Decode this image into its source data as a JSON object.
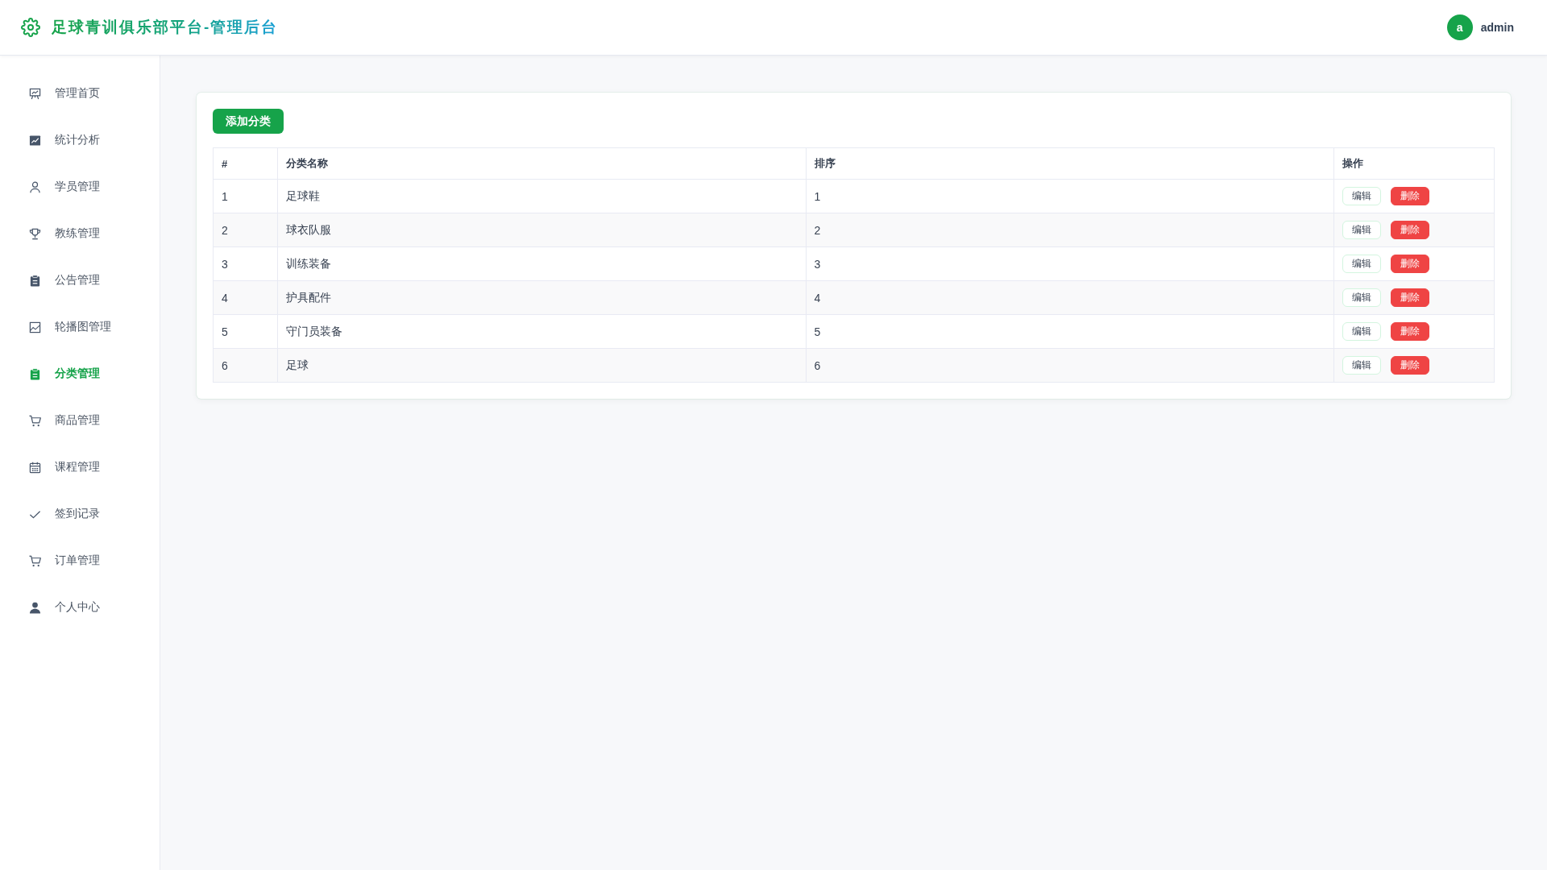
{
  "header": {
    "title": "足球青训俱乐部平台-管理后台",
    "user": {
      "avatar": "a",
      "name": "admin"
    }
  },
  "sidebar": {
    "items": [
      {
        "label": "管理首页",
        "selected": false
      },
      {
        "label": "统计分析",
        "selected": false
      },
      {
        "label": "学员管理",
        "selected": false
      },
      {
        "label": "教练管理",
        "selected": false
      },
      {
        "label": "公告管理",
        "selected": false
      },
      {
        "label": "轮播图管理",
        "selected": false
      },
      {
        "label": "分类管理",
        "selected": true
      },
      {
        "label": "商品管理",
        "selected": false
      },
      {
        "label": "课程管理",
        "selected": false
      },
      {
        "label": "签到记录",
        "selected": false
      },
      {
        "label": "订单管理",
        "selected": false
      },
      {
        "label": "个人中心",
        "selected": false
      }
    ]
  },
  "toolbar": {
    "add_button": "添加分类"
  },
  "table": {
    "columns": [
      "#",
      "分类名称",
      "排序",
      "操作"
    ],
    "rows": [
      {
        "index": "1",
        "name": "足球鞋",
        "sort_order": "1",
        "actions": [
          {
            "kind": "edit",
            "label": "编辑"
          },
          {
            "kind": "delete",
            "label": "删除"
          }
        ]
      },
      {
        "index": "2",
        "name": "球衣队服",
        "sort_order": "2",
        "actions": [
          {
            "kind": "edit",
            "label": "编辑"
          },
          {
            "kind": "delete",
            "label": "删除"
          }
        ]
      },
      {
        "index": "3",
        "name": "训练装备",
        "sort_order": "3",
        "actions": [
          {
            "kind": "edit",
            "label": "编辑"
          },
          {
            "kind": "delete",
            "label": "删除"
          }
        ]
      },
      {
        "index": "4",
        "name": "护具配件",
        "sort_order": "4",
        "actions": [
          {
            "kind": "edit",
            "label": "编辑"
          },
          {
            "kind": "delete",
            "label": "删除"
          }
        ]
      },
      {
        "index": "5",
        "name": "守门员装备",
        "sort_order": "5",
        "actions": [
          {
            "kind": "edit",
            "label": "编辑"
          },
          {
            "kind": "delete",
            "label": "删除"
          }
        ]
      },
      {
        "index": "6",
        "name": "足球",
        "sort_order": "6",
        "actions": [
          {
            "kind": "edit",
            "label": "编辑"
          },
          {
            "kind": "delete",
            "label": "删除"
          }
        ]
      }
    ]
  }
}
